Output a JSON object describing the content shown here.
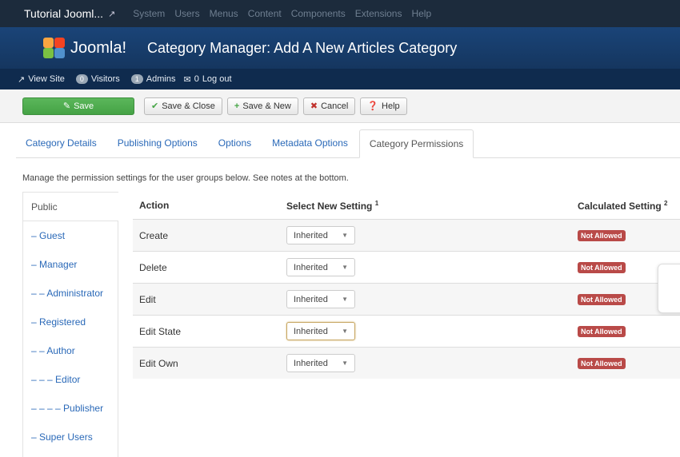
{
  "topbar": {
    "site_name": "Tutorial Jooml...",
    "site_icon": "external-link-icon",
    "menu": [
      "System",
      "Users",
      "Menus",
      "Content",
      "Components",
      "Extensions",
      "Help"
    ]
  },
  "header": {
    "logo_text": "Joomla!",
    "title": "Category Manager: Add A New Articles Category"
  },
  "status": {
    "view_site": "View Site",
    "visitors_count": "0",
    "visitors_label": "Visitors",
    "admins_count": "1",
    "admins_label": "Admins",
    "messages_count": "0",
    "logout_label": "Log out"
  },
  "toolbar": {
    "save": "Save",
    "save_close": "Save & Close",
    "save_new": "Save & New",
    "cancel": "Cancel",
    "help": "Help"
  },
  "tabs": [
    "Category Details",
    "Publishing Options",
    "Options",
    "Metadata Options",
    "Category Permissions"
  ],
  "active_tab": "Category Permissions",
  "intro": "Manage the permission settings for the user groups below. See notes at the bottom.",
  "groups": [
    "Public",
    "– Guest",
    "– Manager",
    "– – Administrator",
    "– Registered",
    "– – Author",
    "– – – Editor",
    "– – – – Publisher",
    "– Super Users"
  ],
  "active_group": "Public",
  "table": {
    "col_action": "Action",
    "col_setting": "Select New Setting",
    "col_setting_sup": "1",
    "col_calc": "Calculated Setting",
    "col_calc_sup": "2",
    "rows": [
      {
        "action": "Create",
        "setting": "Inherited",
        "calc": "Not Allowed"
      },
      {
        "action": "Delete",
        "setting": "Inherited",
        "calc": "Not Allowed"
      },
      {
        "action": "Edit",
        "setting": "Inherited",
        "calc": "Not Allowed"
      },
      {
        "action": "Edit State",
        "setting": "Inherited",
        "calc": "Not Allowed"
      },
      {
        "action": "Edit Own",
        "setting": "Inherited",
        "calc": "Not Allowed"
      }
    ]
  },
  "colors": {
    "topbar": "#1c2b3c",
    "header": "#173b6c",
    "save_green": "#5bb75b",
    "not_allowed": "#b94a48",
    "link": "#2a69b8"
  }
}
